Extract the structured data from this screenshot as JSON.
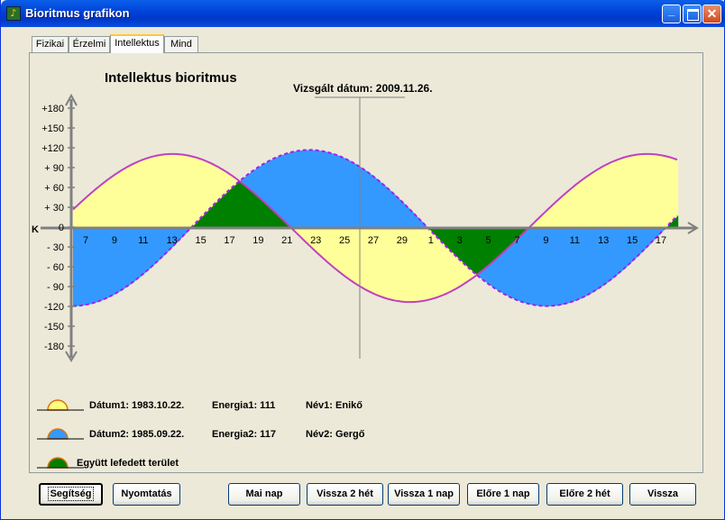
{
  "window": {
    "title": "Bioritmus grafikon"
  },
  "tabs": [
    {
      "label": "Fizikai"
    },
    {
      "label": "Érzelmi"
    },
    {
      "label": "Intellektus",
      "active": true
    },
    {
      "label": "Mind"
    }
  ],
  "chart": {
    "title": "Intellektus bioritmus",
    "date_label": "Vizsgált dátum: 2009.11.26.",
    "k_label": "K",
    "y_ticks": [
      "+180",
      "+150",
      "+120",
      "+ 90",
      "+ 60",
      "+ 30",
      "0",
      "- 30",
      "- 60",
      "- 90",
      "-120",
      "-150",
      "-180"
    ],
    "x_ticks": [
      "7",
      "9",
      "11",
      "13",
      "15",
      "17",
      "19",
      "21",
      "23",
      "25",
      "27",
      "29",
      "1",
      "3",
      "5",
      "7",
      "9",
      "11",
      "13",
      "15",
      "17"
    ]
  },
  "chart_data": {
    "type": "area",
    "title": "Intellektus bioritmus",
    "ylim": [
      -180,
      180
    ],
    "x": [
      "7",
      "9",
      "11",
      "13",
      "15",
      "17",
      "19",
      "21",
      "23",
      "25",
      "27",
      "29",
      "1",
      "3",
      "5",
      "7",
      "9",
      "11",
      "13",
      "15",
      "17"
    ],
    "period_days": 33,
    "series": [
      {
        "name": "Enikő",
        "amplitude": 111,
        "color": "#FFFF99",
        "line_color": "#C040C0",
        "zero_day_offset": 14.3,
        "trend": "falling"
      },
      {
        "name": "Gergő",
        "amplitude": 117,
        "color": "#3399FF",
        "line_color": "#A020F0",
        "zero_day_offset": 23.8,
        "trend": "falling"
      }
    ],
    "overlap_color": "#008000",
    "marker": "2009.11.26."
  },
  "legend": [
    {
      "date": "Dátum1: 1983.10.22.",
      "energy": "Energia1: 111",
      "name": "Név1: Enikő",
      "color": "#FFFF80"
    },
    {
      "date": "Dátum2: 1985.09.22.",
      "energy": "Energia2: 117",
      "name": "Név2: Gergő",
      "color": "#3399FF"
    },
    {
      "label": "Együtt lefedett terület",
      "color": "#008000"
    }
  ],
  "buttons": {
    "help": "Segítség",
    "print": "Nyomtatás",
    "today": "Mai nap",
    "back2w": "Vissza 2 hét",
    "back1d": "Vissza 1 nap",
    "fwd1d": "Előre 1 nap",
    "fwd2w": "Előre 2 hét",
    "back": "Vissza"
  }
}
